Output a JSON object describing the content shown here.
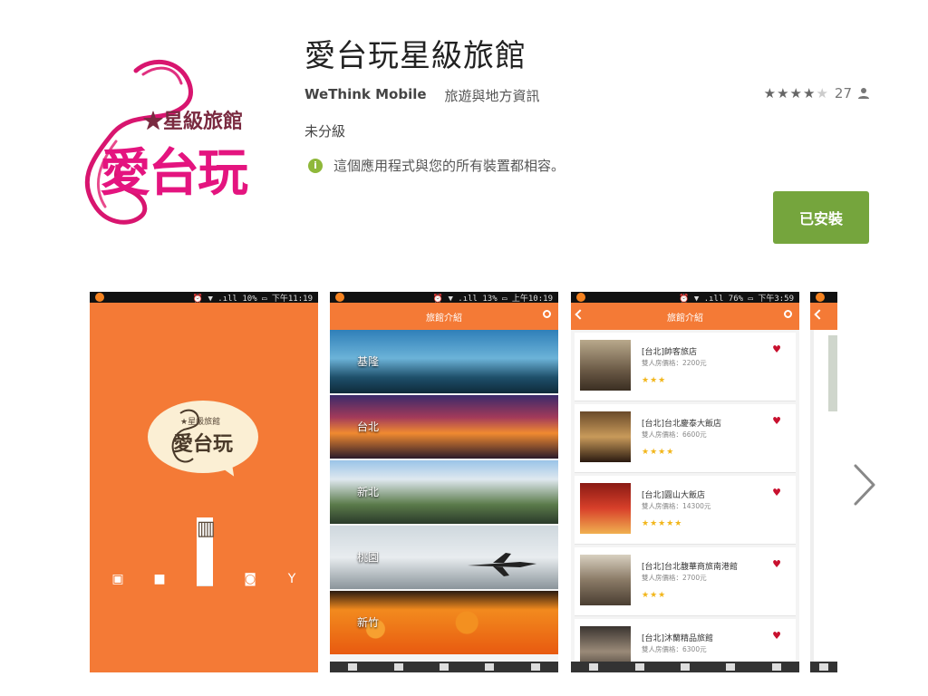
{
  "app": {
    "title": "愛台玩星級旅館",
    "developer": "WeThink Mobile",
    "category": "旅遊與地方資訊",
    "rating_stars": "★★★★",
    "rating_empty": "★",
    "rating_count": "27",
    "content_rating": "未分級",
    "compatibility": "這個應用程式與您的所有裝置都相容。",
    "install_button": "已安裝"
  },
  "logo": {
    "sub_text": "★星級旅館",
    "main_text": "愛台玩"
  },
  "screenshots": {
    "shot1": {
      "status_time": "⏰ ▼ .ıll 10% ▭ 下午11:19",
      "bubble_sub": "★星級旅館",
      "bubble_main": "愛台玩"
    },
    "shot2": {
      "status_time": "⏰ ▼ .ıll 13% ▭ 上午10:19",
      "header": "旅館介紹",
      "regions": [
        "基隆",
        "台北",
        "新北",
        "桃園",
        "新竹"
      ]
    },
    "shot3": {
      "status_time": "⏰ ▼ .ıll 76% ▭ 下午3:59",
      "header": "旅館介紹",
      "hotels": [
        {
          "name": "[台北]帥客旅店",
          "price": "雙人房價格：2200元",
          "stars": "★★★"
        },
        {
          "name": "[台北]台北慶泰大飯店",
          "price": "雙人房價格：6600元",
          "stars": "★★★★"
        },
        {
          "name": "[台北]圓山大飯店",
          "price": "雙人房價格：14300元",
          "stars": "★★★★★"
        },
        {
          "name": "[台北]台北馥華商旅南港館",
          "price": "雙人房價格：2700元",
          "stars": "★★★"
        },
        {
          "name": "[台北]沐蘭精品旅館",
          "price": "雙人房價格：6300元",
          "stars": ""
        }
      ]
    }
  },
  "colors": {
    "accent_orange": "#f47a36",
    "install_green": "#75a53d",
    "logo_pink": "#e4147f",
    "heart_red": "#c8102e",
    "star_gold": "#f2b61b"
  }
}
